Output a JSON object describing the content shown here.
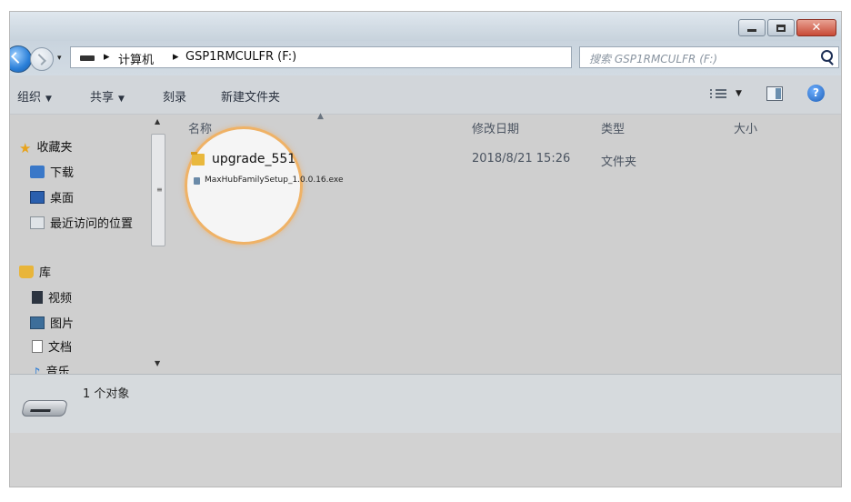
{
  "window": {
    "controls": {
      "minimize": "minimize-icon",
      "maximize": "maximize-icon",
      "close": "✕"
    }
  },
  "address": {
    "sep1": "▸",
    "computer": "计算机",
    "sep2": "▸",
    "drive": "GSP1RMCULFR (F:)",
    "dropdown": "▾",
    "refresh": "↻"
  },
  "search": {
    "placeholder": "搜索 GSP1RMCULFR (F:)"
  },
  "toolbar": {
    "organize": "组织",
    "share": "共享",
    "burn": "刻录",
    "new_folder": "新建文件夹",
    "dropdown_arrow": "▼",
    "help": "?"
  },
  "sidebar": {
    "favorites": "收藏夹",
    "downloads": "下载",
    "desktop": "桌面",
    "recent": "最近访问的位置",
    "libraries": "库",
    "videos": "视频",
    "pictures": "图片",
    "documents": "文档",
    "music": "音乐"
  },
  "scroll": {
    "up": "▲",
    "down": "▼",
    "grip": "≡"
  },
  "columns": {
    "name": "名称",
    "date": "修改日期",
    "type": "类型",
    "size": "大小",
    "sort": "▲"
  },
  "files": [
    {
      "name": "upgrade_551",
      "date": "2018/8/21 15:26",
      "type": "文件夹"
    },
    {
      "name": "MaxHubFamilySetup_1.0.0.16.exe"
    }
  ],
  "status": {
    "text": "1 个对象"
  }
}
